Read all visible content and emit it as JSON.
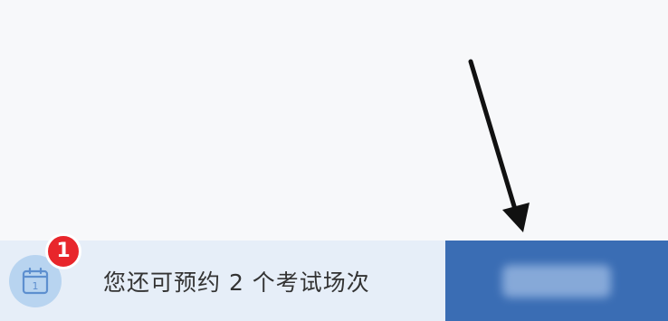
{
  "bottom_bar": {
    "badge_count": "1",
    "calendar_day": "1",
    "remaining_text": "您还可预约 2 个考试场次",
    "action_button": {
      "label_obscured": true
    },
    "colors": {
      "panel_bg": "#e6eef8",
      "button_bg": "#3a6db4",
      "badge_bg": "#e8262b",
      "calendar_circle": "#b8d4f0"
    }
  },
  "annotation": {
    "icon": "arrow-down-pointer-icon"
  }
}
